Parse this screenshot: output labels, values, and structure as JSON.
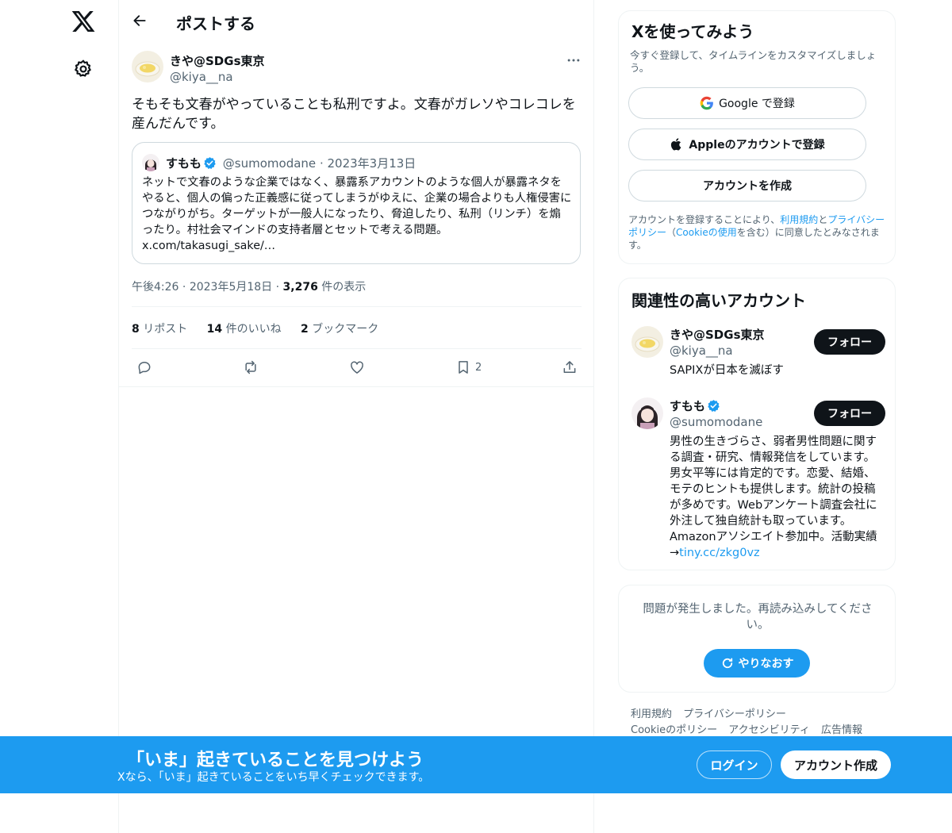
{
  "header": {
    "title": "ポストする"
  },
  "post": {
    "author_name": "きや@SDGs東京",
    "author_handle": "@kiya__na",
    "text": "そもそも文春がやっていることも私刑ですよ。文春がガレソやコレコレを産んだんです。",
    "quote": {
      "author_name": "すもも",
      "author_handle": "@sumomodane",
      "separator": "·",
      "date": "2023年3月13日",
      "text": "ネットで文春のような企業ではなく、暴露系アカウントのような個人が暴露ネタをやると、個人の偏った正義感に従ってしまうがゆえに、企業の場合よりも人権侵害につながりがち。ターゲットが一般人になったり、脅迫したり、私刑（リンチ）を煽ったり。村社会マインドの支持者層とセットで考える問題。 x.com/takasugi_sake/…"
    },
    "time": "午後4:26",
    "date": "2023年5月18日",
    "separator": "·",
    "views_count": "3,276",
    "views_label": "件の表示",
    "reposts_count": "8",
    "reposts_label": "リポスト",
    "likes_count": "14",
    "likes_label": "件のいいね",
    "bookmarks_count": "2",
    "bookmarks_label": "ブックマーク",
    "bookmark_action_count": "2"
  },
  "signup": {
    "title": "Xを使ってみよう",
    "subtitle": "今すぐ登録して、タイムラインをカスタマイズしましょう。",
    "google_label": "Google で登録",
    "apple_label": "Appleのアカウントで登録",
    "create_label": "アカウントを作成",
    "legal_prefix": "アカウントを登録することにより、",
    "legal_terms": "利用規約",
    "legal_and": "と",
    "legal_privacy": "プライバシーポリシー",
    "legal_open": "（",
    "legal_cookie": "Cookieの使用",
    "legal_suffix": "を含む）に同意したとみなされます。"
  },
  "related": {
    "title": "関連性の高いアカウント",
    "accounts": [
      {
        "name": "きや@SDGs東京",
        "handle": "@kiya__na",
        "bio": "SAPIXが日本を滅ぼす",
        "follow_label": "フォロー"
      },
      {
        "name": "すもも",
        "handle": "@sumomodane",
        "bio": "男性の生きづらさ、弱者男性問題に関する調査・研究、情報発信をしています。男女平等には肯定的です。恋愛、結婚、モテのヒントも提供します。統計の投稿が多めです。Webアンケート調査会社に外注して独自統計も取っています。Amazonアソシエイト参加中。活動実績→",
        "bio_link": "tiny.cc/zkg0vz",
        "follow_label": "フォロー"
      }
    ]
  },
  "error": {
    "text": "問題が発生しました。再読み込みしてください。",
    "retry_label": "やりなおす"
  },
  "footer": {
    "links": [
      "利用規約",
      "プライバシーポリシー",
      "Cookieのポリシー",
      "アクセシビリティ",
      "広告情報"
    ]
  },
  "banner": {
    "title": "「いま」起きていることを見つけよう",
    "subtitle": "Xなら、「いま」起きていることをいち早くチェックできます。",
    "login_label": "ログイン",
    "create_label": "アカウント作成"
  },
  "colors": {
    "accent": "#1d9bf0",
    "text": "#0f1419",
    "muted": "#536471",
    "border": "#eff3f4"
  },
  "icons": [
    "x-logo-icon",
    "gear-icon",
    "back-arrow-icon",
    "more-icon",
    "verified-icon",
    "reply-icon",
    "repost-icon",
    "like-icon",
    "bookmark-icon",
    "share-icon",
    "google-icon",
    "apple-icon",
    "refresh-icon"
  ]
}
